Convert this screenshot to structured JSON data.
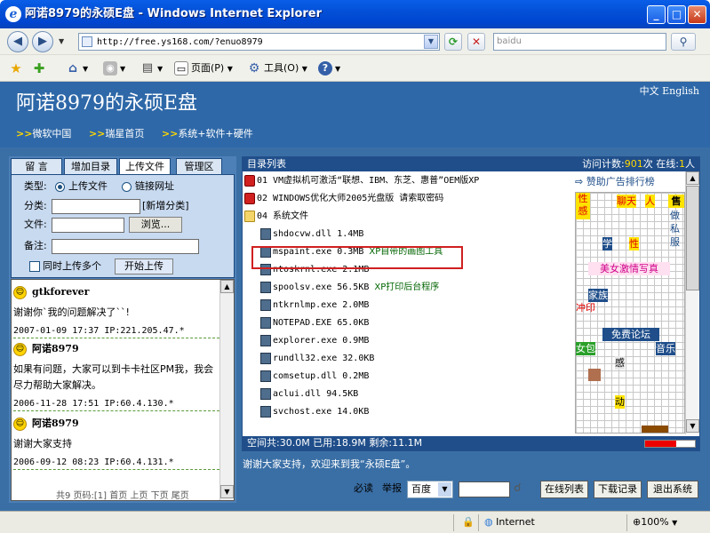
{
  "window": {
    "title": "阿诺8979的永硕E盘 - Windows Internet Explorer",
    "min_label": "_",
    "max_label": "□",
    "close_label": "✕"
  },
  "address": {
    "url": "http://free.ys168.com/?enuo8979",
    "search_placeholder": "baidu"
  },
  "commandbar": {
    "page_label": "页面(P)",
    "tools_label": "工具(O)"
  },
  "header": {
    "site_title": "阿诺8979的永硕E盘",
    "lang": "中文 English",
    "links": [
      "微软中国",
      "瑞星首页",
      "系统+软件+硬件"
    ]
  },
  "tabs": [
    "留 言",
    "增加目录",
    "上传文件",
    "管理区"
  ],
  "upload": {
    "type_label": "类型:",
    "opt_upload": "上传文件",
    "opt_link": "链接网址",
    "category_label": "分类:",
    "new_category": "[新增分类]",
    "file_label": "文件:",
    "browse": "浏览...",
    "note_label": "备注:",
    "multi_label": "同时上传多个",
    "start_button": "开始上传"
  },
  "messages": [
    {
      "name": "gtkforever",
      "text": "谢谢你`我的问题解决了``!",
      "meta": "2007-01-09 17:37 IP:221.205.47.*"
    },
    {
      "name": "阿诺8979",
      "text": "如果有问题，大家可以到卡卡社区PM我，我会尽力帮助大家解决。",
      "meta": "2006-11-28 17:51 IP:60.4.130.*"
    },
    {
      "name": "阿诺8979",
      "text": "谢谢大家支持",
      "meta": "2006-09-12 08:23 IP:60.4.131.*"
    }
  ],
  "msg_pager": "共9 页码:[1] 首页 上页 下页 尾页",
  "list": {
    "header_left": "目录列表",
    "visits_label": "访问计数:",
    "visits": "901",
    "visits_unit": "次",
    "online_label": "在线:",
    "online": "1",
    "online_unit": "人",
    "items": [
      {
        "kind": "lock",
        "name": "01 VM虚拟机可激活“联想、IBM、东芝、惠普”OEM版XP",
        "desc": ""
      },
      {
        "kind": "lock",
        "name": "02 WINDOWS优化大师2005光盘版 请索取密码",
        "desc": ""
      },
      {
        "kind": "folder",
        "name": "04 系统文件",
        "desc": ""
      },
      {
        "kind": "file",
        "name": "shdocvw.dll 1.4MB",
        "desc": ""
      },
      {
        "kind": "file",
        "name": "mspaint.exe 0.3MB",
        "desc": "XP自带的画图工具"
      },
      {
        "kind": "file",
        "name": "ntoskrnl.exe 2.1MB",
        "desc": ""
      },
      {
        "kind": "file",
        "name": "spoolsv.exe 56.5KB",
        "desc": "XP打印后台程序"
      },
      {
        "kind": "file",
        "name": "ntkrnlmp.exe 2.0MB",
        "desc": ""
      },
      {
        "kind": "file",
        "name": "NOTEPAD.EXE 65.0KB",
        "desc": ""
      },
      {
        "kind": "file",
        "name": "explorer.exe 0.9MB",
        "desc": ""
      },
      {
        "kind": "file",
        "name": "rundll32.exe 32.0KB",
        "desc": ""
      },
      {
        "kind": "file",
        "name": "comsetup.dll 0.2MB",
        "desc": ""
      },
      {
        "kind": "file",
        "name": "aclui.dll 94.5KB",
        "desc": ""
      },
      {
        "kind": "file",
        "name": "svchost.exe 14.0KB",
        "desc": ""
      }
    ]
  },
  "ads": {
    "title": "赞助广告排行榜",
    "items": [
      "性感",
      "聊天",
      "人",
      "售",
      "做",
      "私",
      "服",
      "学",
      "性",
      "美女激情写真",
      "家族",
      "冲印",
      "免费论坛",
      "女包",
      "音乐",
      "感",
      "动"
    ]
  },
  "space": {
    "text": "空间共:30.0M 已用:18.9M 剩余:11.1M",
    "used_fraction": 0.63
  },
  "welcome": "谢谢大家支持，欢迎来到我“永硕E盘”。",
  "bottom": {
    "must_read": "必读",
    "report": "举报",
    "engine": "百度",
    "online_list": "在线列表",
    "download_log": "下载记录",
    "logout": "退出系统"
  },
  "status": {
    "zone": "Internet",
    "zoom": "100%"
  }
}
